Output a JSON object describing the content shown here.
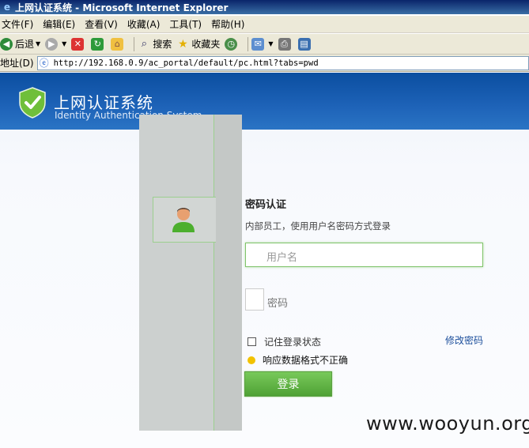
{
  "window": {
    "title": "上网认证系统 - Microsoft Internet Explorer"
  },
  "menu": {
    "items": [
      "文件(F)",
      "编辑(E)",
      "查看(V)",
      "收藏(A)",
      "工具(T)",
      "帮助(H)"
    ]
  },
  "toolbar": {
    "back_label": "后退",
    "search_label": "搜索",
    "favorites_label": "收藏夹"
  },
  "address": {
    "label": "地址(D)",
    "url": "http://192.168.0.9/ac_portal/default/pc.html?tabs=pwd"
  },
  "header": {
    "title_cn": "上网认证系统",
    "title_en": "Identity Authentication System"
  },
  "login": {
    "title": "密码认证",
    "description": "内部员工，使用用户名密码方式登录",
    "username_placeholder": "用户名",
    "password_placeholder": "密码",
    "remember_label": "记住登录状态",
    "change_password_link": "修改密码",
    "error_message": "响应数据格式不正确",
    "submit_label": "登录"
  },
  "watermark": "www.wooyun.org",
  "colors": {
    "header_blue": "#1e63b8",
    "button_green": "#5fb444",
    "input_border": "#7fc36a",
    "link_blue": "#1d4f9c"
  },
  "icons": [
    "ie-logo-icon",
    "back-icon",
    "forward-icon",
    "stop-icon",
    "refresh-icon",
    "home-icon",
    "search-icon",
    "favorites-icon",
    "history-icon",
    "mail-icon",
    "print-icon",
    "edit-icon",
    "page-icon",
    "shield-logo-icon",
    "user-avatar-icon",
    "warning-dot-icon"
  ]
}
